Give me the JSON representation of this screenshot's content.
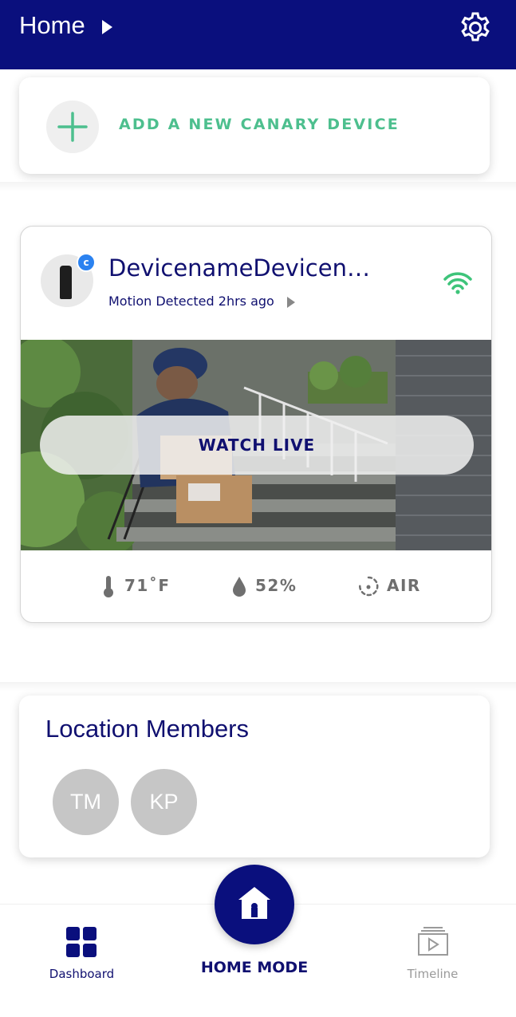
{
  "header": {
    "title": "Home",
    "settings_icon": "gear-icon"
  },
  "add_device": {
    "label": "ADD A NEW CANARY DEVICE",
    "icon": "plus-icon",
    "accent": "#4dbf8e"
  },
  "device": {
    "name": "DevicenameDevicen…",
    "badge": "c",
    "status": "Motion Detected 2hrs ago",
    "wifi_icon": "wifi-icon",
    "watch_live_label": "WATCH LIVE",
    "stats": {
      "temperature": "71˚F",
      "humidity": "52%",
      "air": "AIR"
    }
  },
  "members": {
    "title": "Location Members",
    "list": [
      {
        "initials": "TM"
      },
      {
        "initials": "KP"
      }
    ]
  },
  "bottom_nav": {
    "dashboard_label": "Dashboard",
    "home_mode_label": "HOME MODE",
    "timeline_label": "Timeline"
  },
  "colors": {
    "primary": "#0a0f7d",
    "accent_green": "#4dbf8e",
    "muted": "#6f6f6f"
  }
}
